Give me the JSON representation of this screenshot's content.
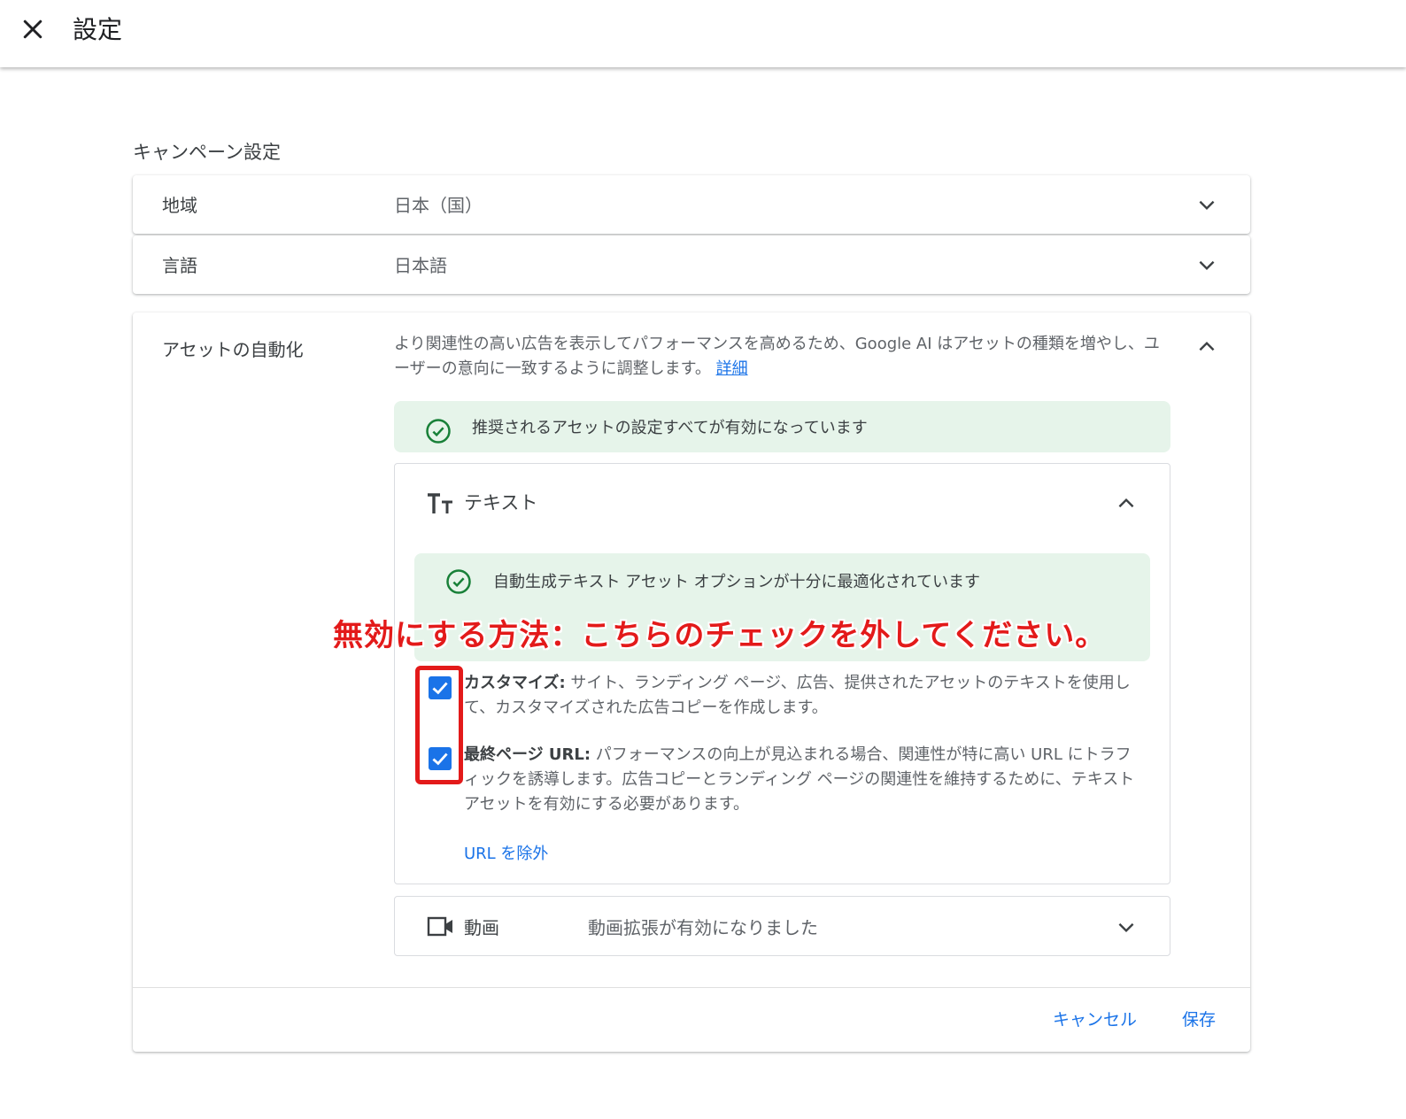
{
  "header": {
    "title": "設定"
  },
  "section": {
    "title": "キャンペーン設定"
  },
  "rows": [
    {
      "label": "地域",
      "value": "日本（国）"
    },
    {
      "label": "言語",
      "value": "日本語"
    }
  ],
  "assets": {
    "label": "アセットの自動化",
    "description": "より関連性の高い広告を表示してパフォーマンスを高めるため、Google AI はアセットの種類を増やし、ユーザーの意向に一致するように調整します。",
    "details_link": "詳細",
    "banner": "推奨されるアセットの設定すべてが有効になっています",
    "text_section": {
      "title": "テキスト",
      "banner": "自動生成テキスト アセット オプションが十分に最適化されています",
      "options": [
        {
          "title": "カスタマイズ:",
          "body": "サイト、ランディング ページ、広告、提供されたアセットのテキストを使用して、カスタマイズされた広告コピーを作成します。",
          "checked": true
        },
        {
          "title": "最終ページ URL:",
          "body": "パフォーマンスの向上が見込まれる場合、関連性が特に高い URL にトラフィックを誘導します。広告コピーとランディング ページの関連性を維持するために、テキスト アセットを有効にする必要があります。",
          "checked": true
        }
      ],
      "exclude_link": "URL を除外"
    },
    "video_section": {
      "title": "動画",
      "status": "動画拡張が有効になりました"
    }
  },
  "annotation": "無効にする方法：こちらのチェックを外してください。",
  "footer": {
    "cancel": "キャンセル",
    "save": "保存"
  },
  "colors": {
    "accent": "#1a73e8",
    "success_bg": "#e6f4ea",
    "success_icon": "#188038",
    "annotation": "#e31a1a"
  }
}
